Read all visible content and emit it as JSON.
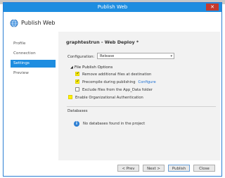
{
  "window": {
    "title": "Publish Web",
    "close_label": "✕"
  },
  "header": {
    "icon": "globe-icon",
    "title": "Publish Web"
  },
  "sidebar": {
    "items": [
      {
        "label": "Profile",
        "active": false
      },
      {
        "label": "Connection",
        "active": false
      },
      {
        "label": "Settings",
        "active": true
      },
      {
        "label": "Preview",
        "active": false
      }
    ]
  },
  "main": {
    "profile_title": "graphtestrun - Web Deploy *",
    "configuration": {
      "label": "Configuration:",
      "value": "Release"
    },
    "file_publish_options": {
      "heading": "File Publish Options",
      "options": [
        {
          "label": "Remove additional files at destination",
          "checked": true,
          "highlighted": true
        },
        {
          "label": "Precompile during publishing",
          "checked": true,
          "highlighted": true,
          "link": "Configure"
        },
        {
          "label": "Exclude files from the App_Data folder",
          "checked": false,
          "highlighted": false
        },
        {
          "label": "Enable Organizational Authentication",
          "checked": false,
          "highlighted": true
        }
      ]
    },
    "databases": {
      "heading": "Databases",
      "empty_message": "No databases found in the project"
    }
  },
  "footer": {
    "prev_label": "< Prev",
    "next_label": "Next >",
    "publish_label": "Publish",
    "close_label": "Close"
  },
  "colors": {
    "accent": "#1e8de0",
    "highlight": "#fff200",
    "close_button": "#c43a2e"
  }
}
